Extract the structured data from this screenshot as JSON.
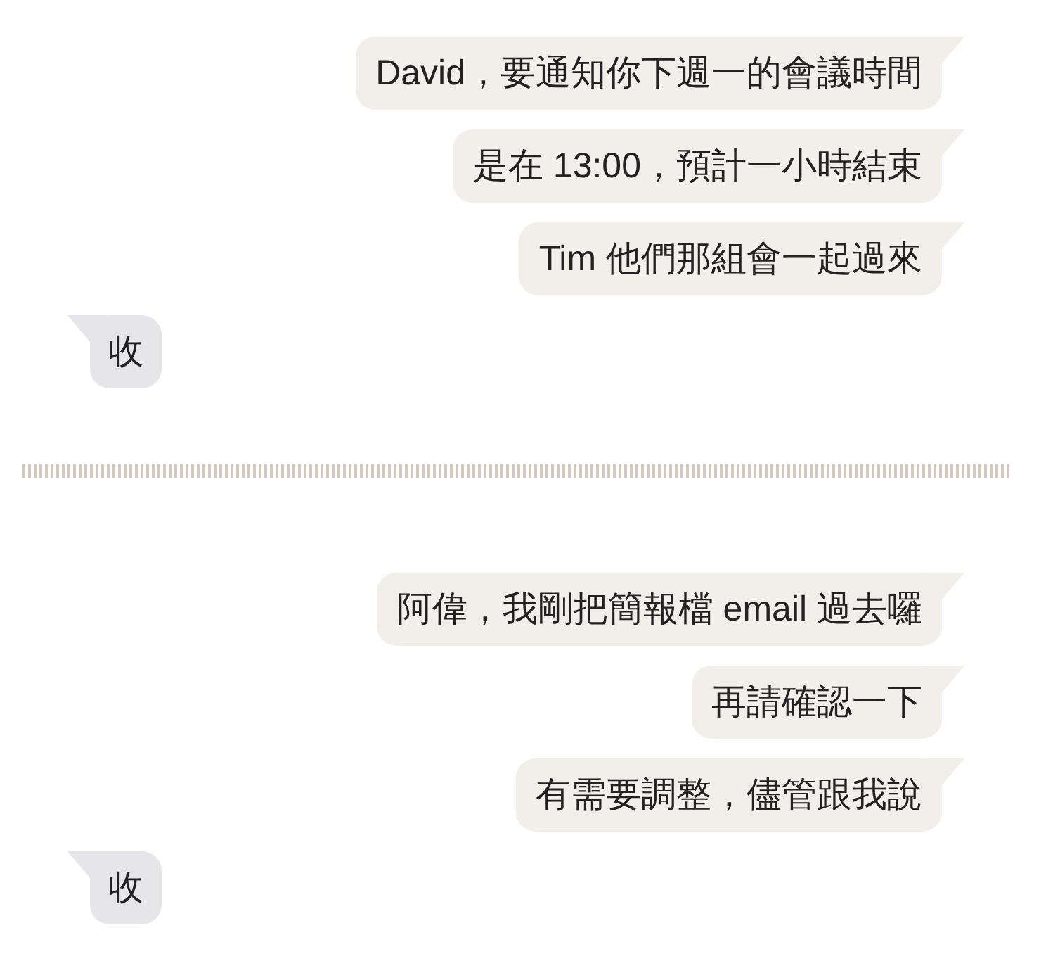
{
  "conversations": [
    {
      "messages": [
        {
          "kind": "sent",
          "text": "David，要通知你下週一的會議時間"
        },
        {
          "kind": "sent",
          "text": "是在 13:00，預計一小時結束"
        },
        {
          "kind": "sent",
          "text": "Tim 他們那組會一起過來"
        },
        {
          "kind": "received",
          "text": "收"
        }
      ]
    },
    {
      "messages": [
        {
          "kind": "sent",
          "text": "阿偉，我剛把簡報檔 email 過去囉"
        },
        {
          "kind": "sent",
          "text": "再請確認一下"
        },
        {
          "kind": "sent",
          "text": "有需要調整，儘管跟我說"
        },
        {
          "kind": "received",
          "text": "收"
        }
      ]
    }
  ]
}
